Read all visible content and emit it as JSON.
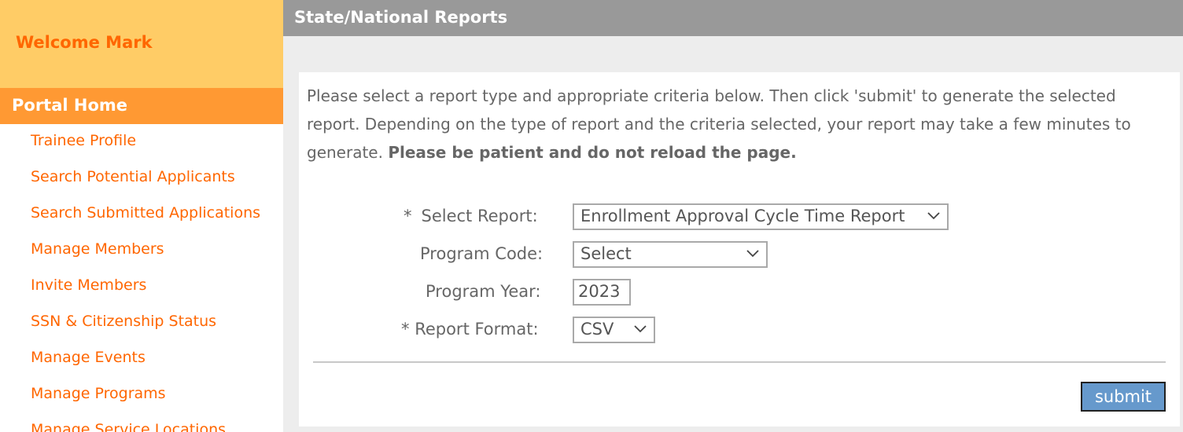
{
  "sidebar": {
    "welcome": "Welcome Mark",
    "portal_home": "Portal Home",
    "items": [
      {
        "label": "Trainee Profile"
      },
      {
        "label": "Search Potential Applicants"
      },
      {
        "label": "Search Submitted Applications"
      },
      {
        "label": "Manage Members"
      },
      {
        "label": "Invite Members"
      },
      {
        "label": "SSN & Citizenship Status"
      },
      {
        "label": "Manage Events"
      },
      {
        "label": "Manage Programs"
      },
      {
        "label": "Manage Service Locations"
      }
    ]
  },
  "header": {
    "title": "State/National Reports"
  },
  "intro": {
    "text": "Please select a report type and appropriate criteria below. Then click 'submit' to generate the selected report. Depending on the type of report and the criteria selected, your report may take a few minutes to generate. ",
    "bold": "Please be patient and do not reload the page."
  },
  "form": {
    "select_report": {
      "required_mark": "*",
      "label": "Select Report:",
      "value": "Enrollment Approval Cycle Time Report"
    },
    "program_code": {
      "label": "Program Code:",
      "value": "Select"
    },
    "program_year": {
      "label": "Program Year:",
      "value": "2023"
    },
    "report_format": {
      "required_mark": "*",
      "label": "Report Format:",
      "value": "CSV"
    },
    "submit_label": "submit"
  },
  "colors": {
    "accent_orange": "#ff6600",
    "welcome_bg": "#ffcc66",
    "portal_home_bg": "#ff9933",
    "header_bg": "#999999",
    "submit_bg": "#6699cc"
  },
  "icons": {
    "dropdown": "chevron-down-icon"
  }
}
